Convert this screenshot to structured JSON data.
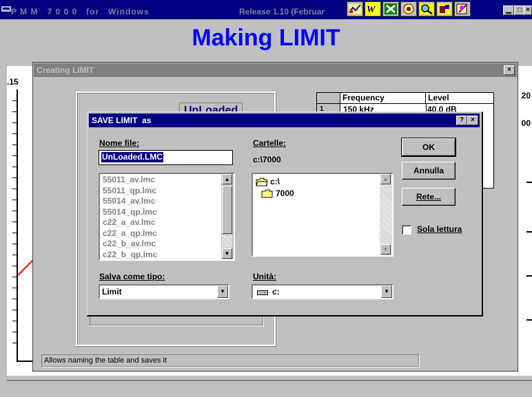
{
  "app": {
    "title": "P M M   7 0 0 0   for   Windows",
    "release": "Release 1.10 (Februar"
  },
  "main": {
    "heading": "Making LIMIT",
    "axis_top_label": ".15",
    "right_label_1": "20",
    "right_label_2": "00"
  },
  "creating": {
    "title": "Creating LIMIT",
    "preview_text": "UnLoaded",
    "table": {
      "headers": [
        "Frequency",
        "Level"
      ],
      "first_row": {
        "index": "1",
        "frequency": "150 kHz",
        "level": "40.0 dB"
      }
    },
    "status": "Allows naming the table and saves it"
  },
  "dialog": {
    "title": "SAVE LIMIT  as",
    "file_name_label": "Nome file:",
    "file_name_value": "UnLoaded.LMC",
    "files": [
      "55011_av.lmc",
      "55011_qp.lmc",
      "55014_av.lmc",
      "55014_qp.lmc",
      "c22_a_av.lmc",
      "c22_a_qp.lmc",
      "c22_b_av.lmc",
      "c22_b_qp.lmc"
    ],
    "folders_label": "Cartelle:",
    "current_path": "c:\\7000",
    "folders": [
      "c:\\",
      "7000"
    ],
    "ok": "OK",
    "cancel": "Annulla",
    "network": "Rete...",
    "readonly_label": "Sola lettura",
    "type_label": "Salva come tipo:",
    "type_value": "Limit",
    "drive_label": "Unità:",
    "drive_value": "c:"
  },
  "colors": {
    "title_bar": "#000080",
    "heading": "#0000ff",
    "curve": "#ff0000",
    "selection": "#000080"
  },
  "icons": [
    "app-icon",
    "toolbar-chart-icon",
    "toolbar-w-icon",
    "toolbar-xls-icon",
    "toolbar-flower-icon",
    "toolbar-search-icon",
    "toolbar-tool-icon",
    "toolbar-pen-icon",
    "folder-open-icon",
    "folder-icon",
    "drive-icon",
    "help-icon",
    "close-icon",
    "minimize-icon",
    "maximize-icon"
  ]
}
